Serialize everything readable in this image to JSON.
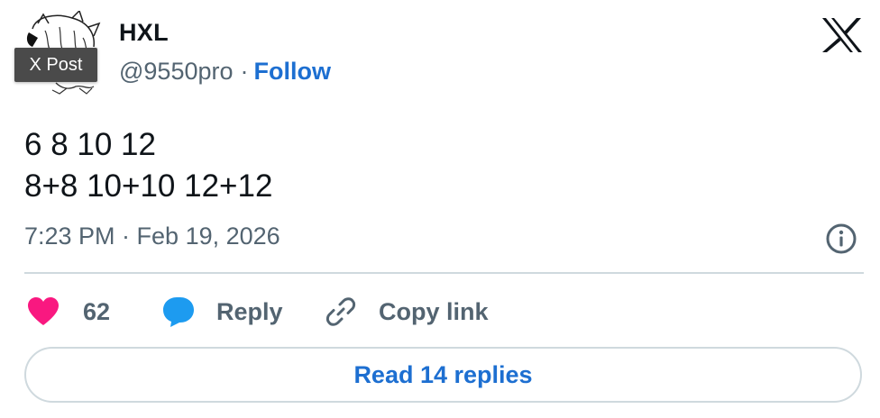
{
  "header": {
    "tooltip": "X Post",
    "display_name": "HXL",
    "handle": "@9550pro",
    "separator": "·",
    "follow_label": "Follow",
    "logo_icon": "x-logo-icon"
  },
  "tweet": {
    "text": "6 8 10 12\n8+8 10+10 12+12",
    "timestamp": "7:23 PM · Feb 19, 2026"
  },
  "actions": {
    "like_count": "62",
    "like_icon": "heart-icon",
    "like_color": "#f91880",
    "reply_label": "Reply",
    "reply_icon": "speech-bubble-icon",
    "reply_icon_color": "#1d9bf0",
    "copy_label": "Copy link",
    "copy_icon": "link-icon"
  },
  "footer": {
    "read_replies_label": "Read 14 replies"
  },
  "colors": {
    "accent": "#1d6fd1",
    "muted": "#536471",
    "divider": "#cfd9de"
  }
}
